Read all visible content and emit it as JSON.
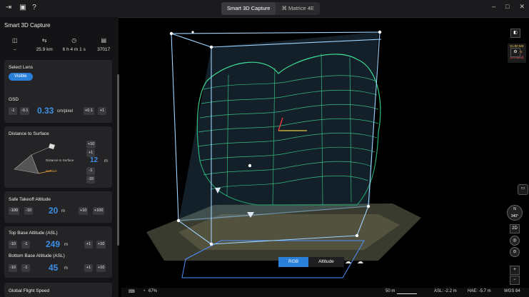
{
  "topbar": {
    "tabs": [
      {
        "label": "Smart 3D Capture"
      },
      {
        "label": "Matrice 4E"
      }
    ],
    "window_buttons": [
      "–",
      "□",
      "✕"
    ]
  },
  "panel": {
    "title": "Smart 3D Capture",
    "stats": [
      {
        "icon": "ruler-icon",
        "value": "--"
      },
      {
        "icon": "distance-icon",
        "value": "25.9 km"
      },
      {
        "icon": "clock-icon",
        "value": "6 h 4 m 1 s"
      },
      {
        "icon": "photo-count-icon",
        "value": "37017"
      }
    ],
    "lens": {
      "label": "Select Lens",
      "value": "Visible"
    },
    "gsd": {
      "label": "GSD",
      "minus1": "-1",
      "minus01": "-0.1",
      "value": "0.33",
      "unit": "cm/pixel",
      "plus01": "+0.1",
      "plus1": "+1"
    },
    "distance": {
      "label": "Distance to Surface",
      "plus10": "+10",
      "plus1": "+1",
      "value": "12",
      "unit": "m",
      "minus1": "-1",
      "minus10": "-10",
      "diagram_label": "Distance to Surface",
      "diagram_surface": "Surface"
    },
    "takeoff": {
      "label": "Safe Takeoff Altitude",
      "minus100": "-100",
      "minus10": "-10",
      "value": "20",
      "unit": "m",
      "plus10": "+10",
      "plus100": "+100"
    },
    "top_base": {
      "label": "Top Base Altitude (ASL)",
      "minus10": "-10",
      "minus1": "-1",
      "value": "249",
      "unit": "m",
      "plus1": "+1",
      "plus10": "+10"
    },
    "bottom_base": {
      "label": "Bottom Base Altitude (ASL)",
      "minus10": "-10",
      "minus1": "-1",
      "value": "45",
      "unit": "m",
      "plus1": "+1",
      "plus10": "+10"
    },
    "global_speed": {
      "label": "Global Flight Speed"
    }
  },
  "scene": {
    "speed": {
      "ms": "51.80 MS",
      "fps": "20 FPS",
      "status": "(throttled)"
    },
    "lens_toggle": {
      "rgb": "RGB",
      "altitude": "Altitude"
    },
    "compass": {
      "letter": "N",
      "heading": "340°"
    },
    "view_mode": "2D",
    "zoom_in": "+",
    "zoom_out": "−"
  },
  "bottom": {
    "zoom": "67%",
    "scale": "50 m",
    "asl": "ASL: -2.2 m",
    "hae": "HAE: -5.7 m",
    "datum": "WGS 84"
  },
  "colors": {
    "accent": "#2a7fd8",
    "value_blue": "#3d8fe6",
    "wireframe_green": "#3ee39b",
    "box_blue": "#9fd4ff"
  }
}
